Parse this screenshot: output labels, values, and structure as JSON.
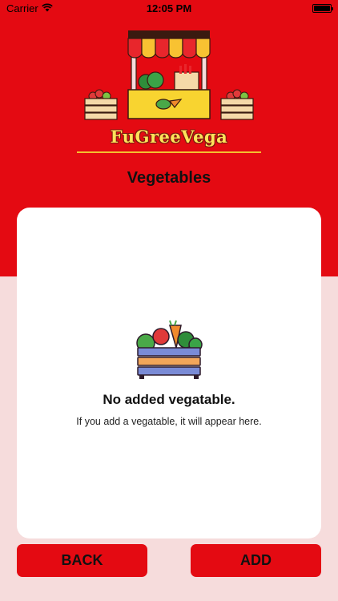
{
  "status_bar": {
    "carrier": "Carrier",
    "time": "12:05 PM"
  },
  "app": {
    "name": "FuGreeVega"
  },
  "page": {
    "title": "Vegetables"
  },
  "empty_state": {
    "title": "No added vegatable.",
    "subtitle": "If you add a vegatable, it will appear here."
  },
  "actions": {
    "back_label": "BACK",
    "add_label": "ADD"
  },
  "colors": {
    "primary": "#e40a12",
    "background": "#f6dcdc",
    "card": "#ffffff",
    "logo_text": "#ffe25a"
  },
  "icons": {
    "logo": "market-stall-icon",
    "empty": "vegetable-crate-icon"
  }
}
